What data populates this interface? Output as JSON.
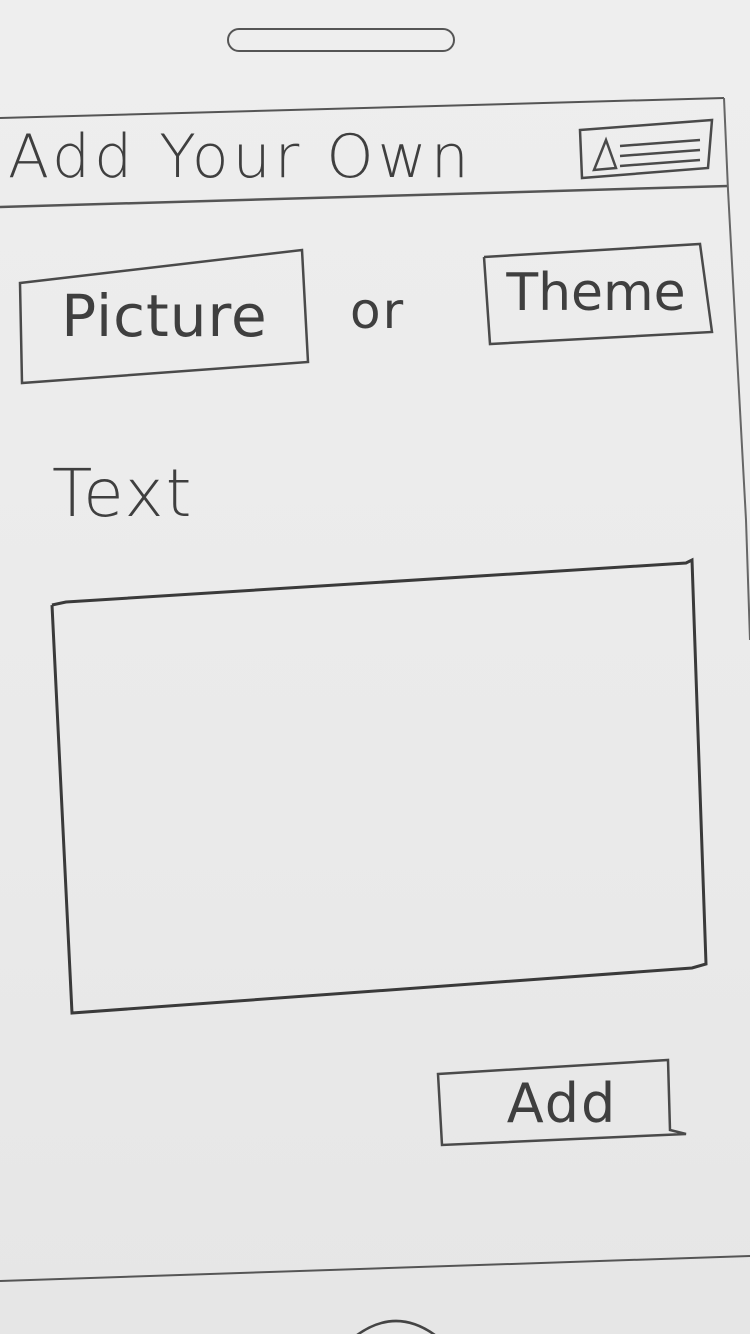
{
  "header": {
    "title": "Add Your Own"
  },
  "media_choice": {
    "picture_label": "Picture",
    "separator": "or",
    "theme_label": "Theme"
  },
  "text_section": {
    "label": "Text",
    "value": "",
    "placeholder": ""
  },
  "actions": {
    "add_label": "Add"
  },
  "icons": {
    "menu": "image-menu-icon",
    "home": "home-button-icon",
    "speaker": "speaker-slot-icon"
  },
  "colors": {
    "paper": "#ececec",
    "pencil": "#3f3f3f"
  }
}
